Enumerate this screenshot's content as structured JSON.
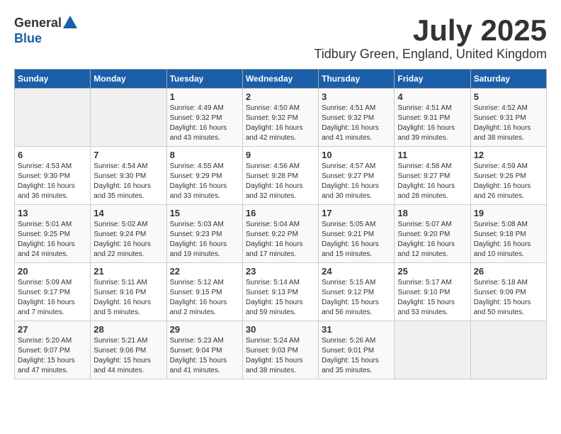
{
  "header": {
    "logo_general": "General",
    "logo_blue": "Blue",
    "month_title": "July 2025",
    "location": "Tidbury Green, England, United Kingdom"
  },
  "calendar": {
    "days_of_week": [
      "Sunday",
      "Monday",
      "Tuesday",
      "Wednesday",
      "Thursday",
      "Friday",
      "Saturday"
    ],
    "weeks": [
      [
        {
          "day": "",
          "info": ""
        },
        {
          "day": "",
          "info": ""
        },
        {
          "day": "1",
          "info": "Sunrise: 4:49 AM\nSunset: 9:32 PM\nDaylight: 16 hours\nand 43 minutes."
        },
        {
          "day": "2",
          "info": "Sunrise: 4:50 AM\nSunset: 9:32 PM\nDaylight: 16 hours\nand 42 minutes."
        },
        {
          "day": "3",
          "info": "Sunrise: 4:51 AM\nSunset: 9:32 PM\nDaylight: 16 hours\nand 41 minutes."
        },
        {
          "day": "4",
          "info": "Sunrise: 4:51 AM\nSunset: 9:31 PM\nDaylight: 16 hours\nand 39 minutes."
        },
        {
          "day": "5",
          "info": "Sunrise: 4:52 AM\nSunset: 9:31 PM\nDaylight: 16 hours\nand 38 minutes."
        }
      ],
      [
        {
          "day": "6",
          "info": "Sunrise: 4:53 AM\nSunset: 9:30 PM\nDaylight: 16 hours\nand 36 minutes."
        },
        {
          "day": "7",
          "info": "Sunrise: 4:54 AM\nSunset: 9:30 PM\nDaylight: 16 hours\nand 35 minutes."
        },
        {
          "day": "8",
          "info": "Sunrise: 4:55 AM\nSunset: 9:29 PM\nDaylight: 16 hours\nand 33 minutes."
        },
        {
          "day": "9",
          "info": "Sunrise: 4:56 AM\nSunset: 9:28 PM\nDaylight: 16 hours\nand 32 minutes."
        },
        {
          "day": "10",
          "info": "Sunrise: 4:57 AM\nSunset: 9:27 PM\nDaylight: 16 hours\nand 30 minutes."
        },
        {
          "day": "11",
          "info": "Sunrise: 4:58 AM\nSunset: 9:27 PM\nDaylight: 16 hours\nand 28 minutes."
        },
        {
          "day": "12",
          "info": "Sunrise: 4:59 AM\nSunset: 9:26 PM\nDaylight: 16 hours\nand 26 minutes."
        }
      ],
      [
        {
          "day": "13",
          "info": "Sunrise: 5:01 AM\nSunset: 9:25 PM\nDaylight: 16 hours\nand 24 minutes."
        },
        {
          "day": "14",
          "info": "Sunrise: 5:02 AM\nSunset: 9:24 PM\nDaylight: 16 hours\nand 22 minutes."
        },
        {
          "day": "15",
          "info": "Sunrise: 5:03 AM\nSunset: 9:23 PM\nDaylight: 16 hours\nand 19 minutes."
        },
        {
          "day": "16",
          "info": "Sunrise: 5:04 AM\nSunset: 9:22 PM\nDaylight: 16 hours\nand 17 minutes."
        },
        {
          "day": "17",
          "info": "Sunrise: 5:05 AM\nSunset: 9:21 PM\nDaylight: 16 hours\nand 15 minutes."
        },
        {
          "day": "18",
          "info": "Sunrise: 5:07 AM\nSunset: 9:20 PM\nDaylight: 16 hours\nand 12 minutes."
        },
        {
          "day": "19",
          "info": "Sunrise: 5:08 AM\nSunset: 9:18 PM\nDaylight: 16 hours\nand 10 minutes."
        }
      ],
      [
        {
          "day": "20",
          "info": "Sunrise: 5:09 AM\nSunset: 9:17 PM\nDaylight: 16 hours\nand 7 minutes."
        },
        {
          "day": "21",
          "info": "Sunrise: 5:11 AM\nSunset: 9:16 PM\nDaylight: 16 hours\nand 5 minutes."
        },
        {
          "day": "22",
          "info": "Sunrise: 5:12 AM\nSunset: 9:15 PM\nDaylight: 16 hours\nand 2 minutes."
        },
        {
          "day": "23",
          "info": "Sunrise: 5:14 AM\nSunset: 9:13 PM\nDaylight: 15 hours\nand 59 minutes."
        },
        {
          "day": "24",
          "info": "Sunrise: 5:15 AM\nSunset: 9:12 PM\nDaylight: 15 hours\nand 56 minutes."
        },
        {
          "day": "25",
          "info": "Sunrise: 5:17 AM\nSunset: 9:10 PM\nDaylight: 15 hours\nand 53 minutes."
        },
        {
          "day": "26",
          "info": "Sunrise: 5:18 AM\nSunset: 9:09 PM\nDaylight: 15 hours\nand 50 minutes."
        }
      ],
      [
        {
          "day": "27",
          "info": "Sunrise: 5:20 AM\nSunset: 9:07 PM\nDaylight: 15 hours\nand 47 minutes."
        },
        {
          "day": "28",
          "info": "Sunrise: 5:21 AM\nSunset: 9:06 PM\nDaylight: 15 hours\nand 44 minutes."
        },
        {
          "day": "29",
          "info": "Sunrise: 5:23 AM\nSunset: 9:04 PM\nDaylight: 15 hours\nand 41 minutes."
        },
        {
          "day": "30",
          "info": "Sunrise: 5:24 AM\nSunset: 9:03 PM\nDaylight: 15 hours\nand 38 minutes."
        },
        {
          "day": "31",
          "info": "Sunrise: 5:26 AM\nSunset: 9:01 PM\nDaylight: 15 hours\nand 35 minutes."
        },
        {
          "day": "",
          "info": ""
        },
        {
          "day": "",
          "info": ""
        }
      ]
    ]
  }
}
